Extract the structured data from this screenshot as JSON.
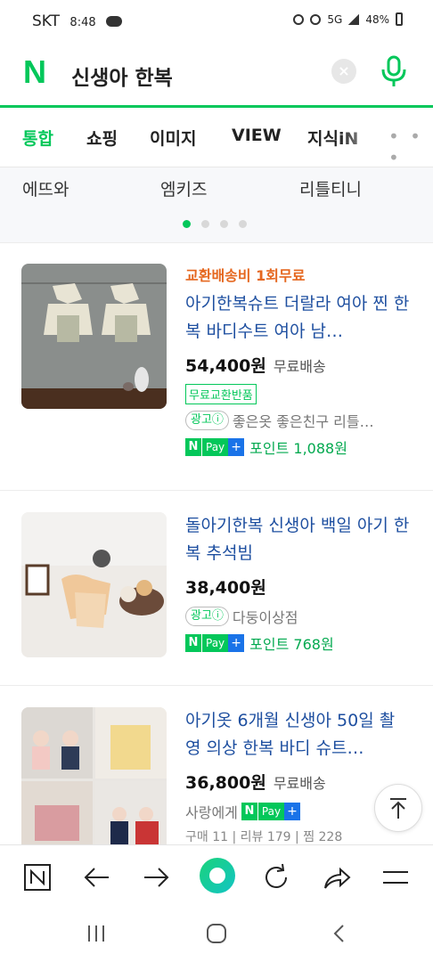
{
  "status": {
    "carrier": "SKT",
    "time": "8:48",
    "network": "5G",
    "battery": "48%"
  },
  "search": {
    "query": "신생아 한복",
    "logo": "N",
    "clear_icon": "×"
  },
  "tabs": [
    {
      "label": "통합",
      "active": true
    },
    {
      "label": "쇼핑",
      "active": false
    },
    {
      "label": "이미지",
      "active": false
    },
    {
      "label": "VIEW",
      "active": false
    },
    {
      "label": "지식iN",
      "active": false
    }
  ],
  "tabs_more": "• • •",
  "brands": [
    "에뜨와",
    "엠키즈",
    "리틀티니"
  ],
  "products": [
    {
      "promo": "교환배송비 1회무료",
      "title": "아기한복슈트 더랄라 여아 찐 한복 바디수트 여아 남…",
      "price": "54,400원",
      "shipping": "무료배송",
      "badge": "무료교환반품",
      "ad": "광고ⓘ",
      "seller": "좋은옷 좋은친구 리틀…",
      "npay": {
        "n": "N",
        "pay": "Pay",
        "plus": "+"
      },
      "point": "포인트 1,088원"
    },
    {
      "title": "돌아기한복 신생아 백일 아기 한복 추석빔",
      "price": "38,400원",
      "ad": "광고ⓘ",
      "seller": "다둥이상점",
      "npay": {
        "n": "N",
        "pay": "Pay",
        "plus": "+"
      },
      "point": "포인트 768원"
    },
    {
      "title": "아기옷 6개월 신생아 50일 촬영 의상 한복 바디 슈트…",
      "price": "36,800원",
      "shipping": "무료배송",
      "seller": "사랑에게",
      "npay": {
        "n": "N",
        "pay": "Pay",
        "plus": "+"
      },
      "meta": "구매 11 | 리뷰 179 | 찜 228"
    }
  ],
  "colors": {
    "brand_green": "#03c75a",
    "link_blue": "#1e4fa0",
    "promo_orange": "#e5671f"
  }
}
